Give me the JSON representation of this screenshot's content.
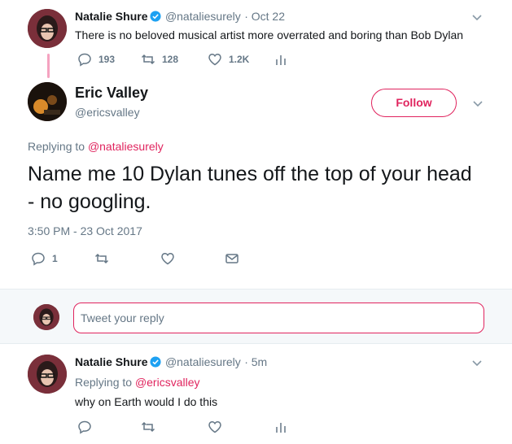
{
  "tweet1": {
    "name": "Natalie Shure",
    "handle": "@nataliesurely",
    "time": "· Oct 22",
    "text": "There is no beloved musical artist more overrated and boring than Bob Dylan",
    "replies": "193",
    "retweets": "128",
    "likes": "1.2K"
  },
  "main_tweet": {
    "name": "Eric Valley",
    "handle": "@ericsvalley",
    "follow_label": "Follow",
    "replying_prefix": "Replying to",
    "replying_to": "@nataliesurely",
    "text": "Name me 10 Dylan tunes off the top of your head - no googling.",
    "timestamp": "3:50 PM - 23 Oct 2017",
    "replies": "1"
  },
  "reply_box": {
    "placeholder": "Tweet your reply"
  },
  "tweet2": {
    "name": "Natalie Shure",
    "handle": "@nataliesurely",
    "time": "· 5m",
    "replying_prefix": "Replying to",
    "replying_to": "@ericsvalley",
    "text": "why on Earth would I do this"
  },
  "colors": {
    "accent": "#e0245e",
    "verified": "#1da1f2",
    "muted": "#657786"
  }
}
